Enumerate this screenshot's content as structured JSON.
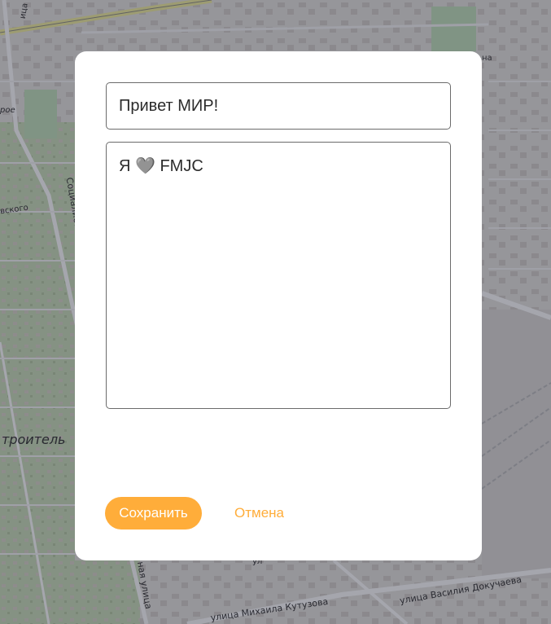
{
  "map": {
    "labels": [
      "улица Михаила Кутузова",
      "улица Василия Докучаева",
      "Социалистическая",
      "троитель",
      "ная улица",
      "вского",
      "рое",
      "ица",
      "на",
      "ул"
    ]
  },
  "dialog": {
    "title_value": "Привет МИР!",
    "body_value": "Я 🩶 FMJC",
    "save_label": "Сохранить",
    "cancel_label": "Отмена"
  },
  "colors": {
    "accent": "#ffad3a",
    "dialog_bg": "#ffffff",
    "overlay": "rgba(40,44,60,0.42)"
  }
}
